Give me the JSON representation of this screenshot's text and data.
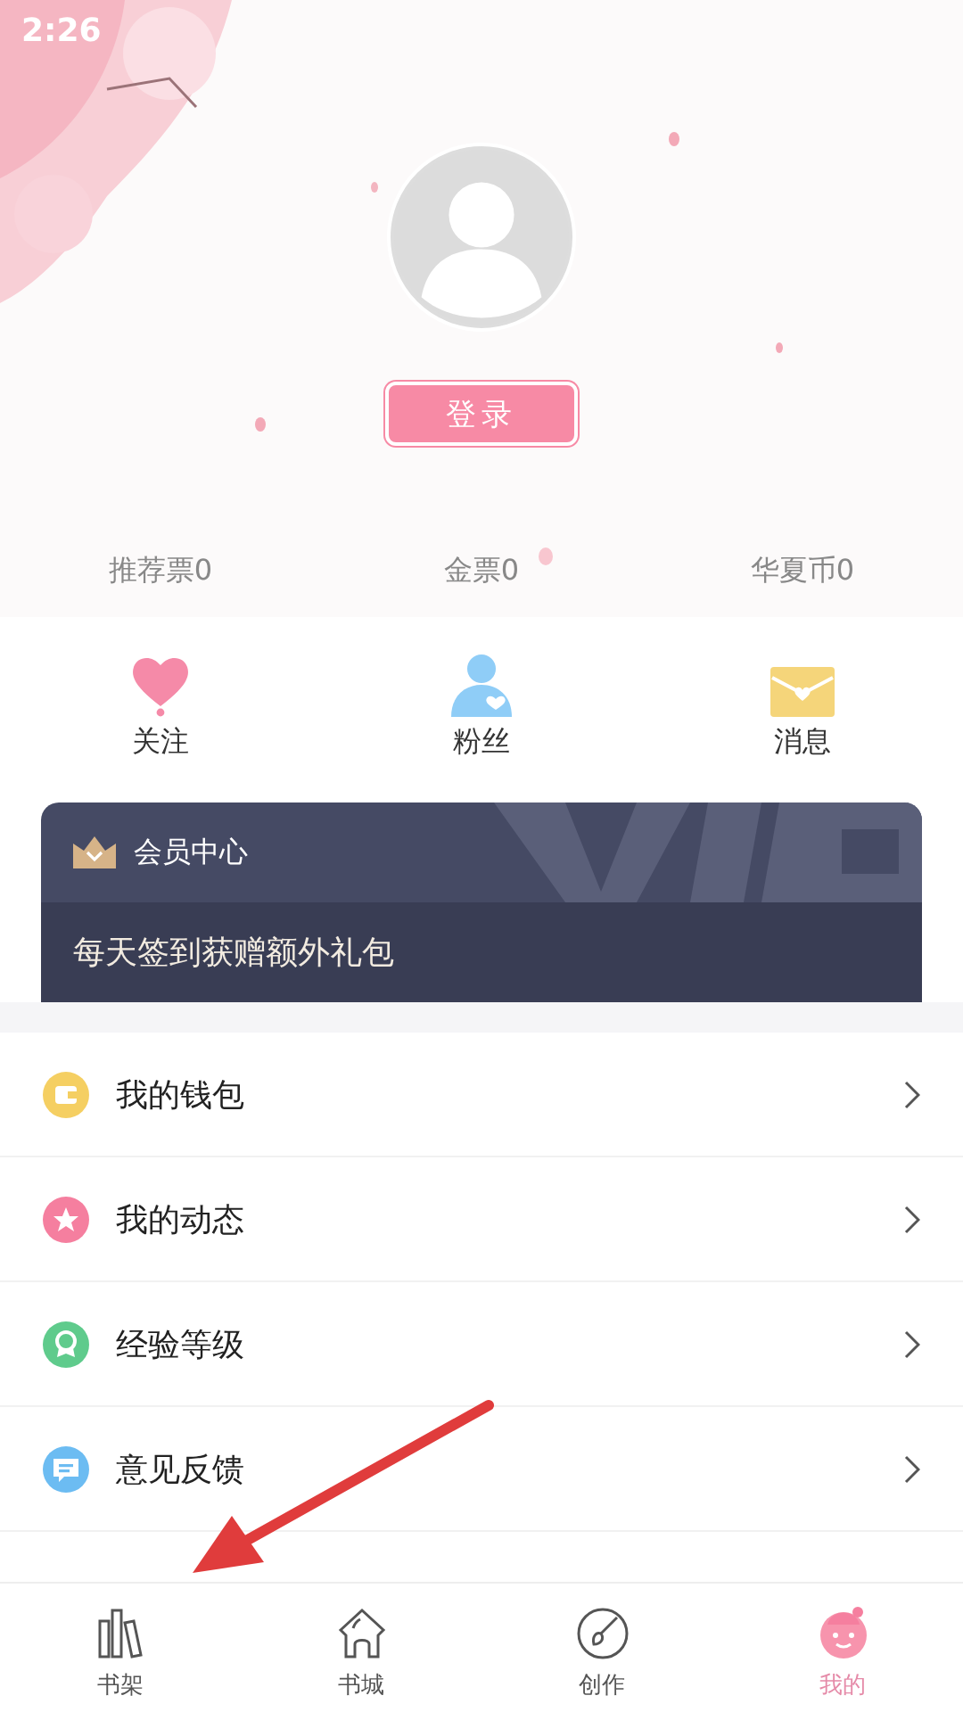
{
  "status_bar": {
    "time": "2:26"
  },
  "profile": {
    "login_button": "登录"
  },
  "stats": [
    "推荐票0",
    "金票0",
    "华夏币0"
  ],
  "shortcuts": [
    {
      "kind": "heart",
      "label": "关注"
    },
    {
      "kind": "fan",
      "label": "粉丝"
    },
    {
      "kind": "mail",
      "label": "消息"
    }
  ],
  "vip_card": {
    "title": "会员中心",
    "subtitle": "每天签到获赠额外礼包"
  },
  "menu": [
    {
      "kind": "wallet",
      "label": "我的钱包"
    },
    {
      "kind": "star",
      "label": "我的动态"
    },
    {
      "kind": "medal",
      "label": "经验等级"
    },
    {
      "kind": "chat",
      "label": "意见反馈"
    }
  ],
  "tabs": [
    {
      "kind": "shelf",
      "label": "书架",
      "selected": false
    },
    {
      "kind": "home",
      "label": "书城",
      "selected": false
    },
    {
      "kind": "brush",
      "label": "创作",
      "selected": false
    },
    {
      "kind": "face",
      "label": "我的",
      "selected": true
    }
  ]
}
